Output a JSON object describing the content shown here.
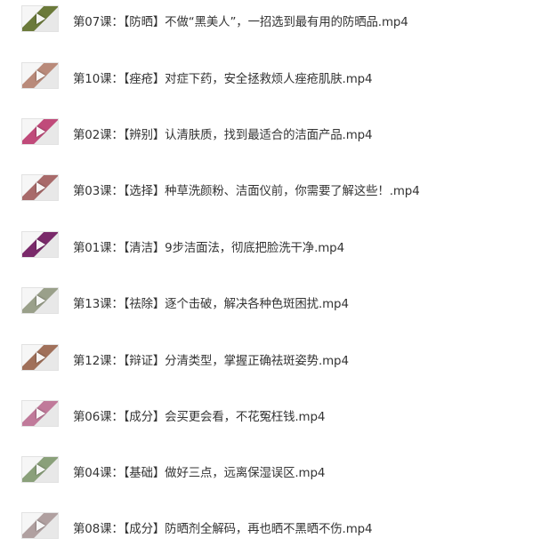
{
  "files": [
    {
      "name": "第07课：【防晒】不做“黑美人”，一招选到最有用的防晒品.mp4",
      "thumb": "video-thumbnail-icon",
      "tint": "#6b7a3a"
    },
    {
      "name": "第10课：【痤疮】对症下药，安全拯救烦人痤疮肌肤.mp4",
      "thumb": "video-thumbnail-icon",
      "tint": "#b98a7a"
    },
    {
      "name": "第02课：【辨别】认清肤质，找到最适合的洁面产品.mp4",
      "thumb": "video-thumbnail-icon",
      "tint": "#c04a7a"
    },
    {
      "name": "第03课：【选择】种草洗颜粉、洁面仪前，你需要了解这些！.mp4",
      "thumb": "video-thumbnail-icon",
      "tint": "#a86a6a"
    },
    {
      "name": "第01课：【清洁】9步洁面法，彻底把脸洗干净.mp4",
      "thumb": "video-thumbnail-icon",
      "tint": "#7a2a6a"
    },
    {
      "name": "第13课：【祛除】逐个击破，解决各种色斑困扰.mp4",
      "thumb": "video-thumbnail-icon",
      "tint": "#9aa08a"
    },
    {
      "name": "第12课：【辩证】分清类型，掌握正确祛斑姿势.mp4",
      "thumb": "video-thumbnail-icon",
      "tint": "#a0705a"
    },
    {
      "name": "第06课：【成分】会买更会看，不花冤枉钱.mp4",
      "thumb": "video-thumbnail-icon",
      "tint": "#c07a9a"
    },
    {
      "name": "第04课：【基础】做好三点，远离保湿误区.mp4",
      "thumb": "video-thumbnail-icon",
      "tint": "#8aa07a"
    },
    {
      "name": "第08课：【成分】防晒剂全解码，再也晒不黑晒不伤.mp4",
      "thumb": "video-thumbnail-icon",
      "tint": "#b0a0a0"
    }
  ]
}
